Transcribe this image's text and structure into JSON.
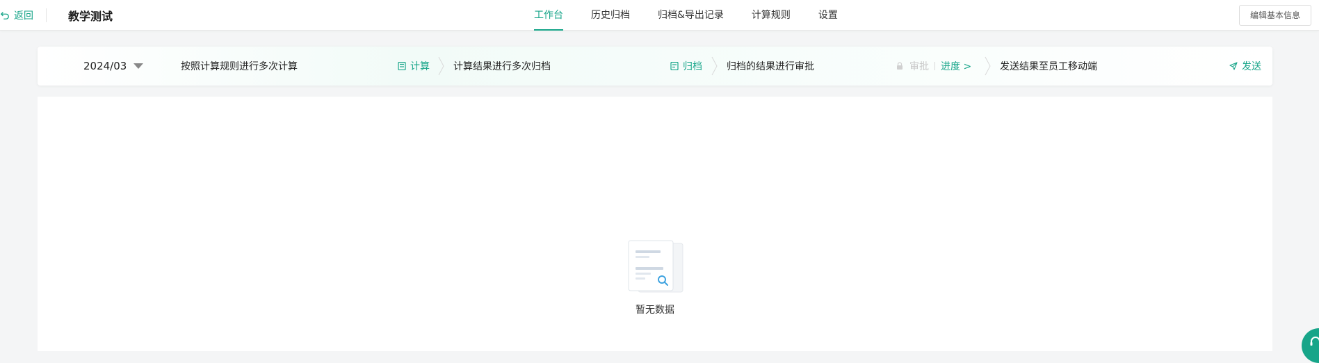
{
  "header": {
    "back_label": "返回",
    "app_title": "教学测试",
    "tabs": [
      {
        "label": "工作台",
        "active": true
      },
      {
        "label": "历史归档",
        "active": false
      },
      {
        "label": "归档&导出记录",
        "active": false
      },
      {
        "label": "计算规则",
        "active": false
      },
      {
        "label": "设置",
        "active": false
      }
    ],
    "edit_button_label": "编辑基本信息"
  },
  "workflow": {
    "period": "2024/03",
    "step1_text": "按照计算规则进行多次计算",
    "calc_action": "计算",
    "step2_text": "计算结果进行多次归档",
    "archive_action": "归档",
    "step3_text": "归档的结果进行审批",
    "approve_action": "审批",
    "progress_link": "进度 >",
    "step4_text": "发送结果至员工移动端",
    "send_action": "发送"
  },
  "main": {
    "empty_text": "暂无数据"
  },
  "colors": {
    "accent": "#17a589",
    "background": "#f4f5f6"
  },
  "icons": [
    "undo-icon",
    "calculator-icon",
    "archive-icon",
    "lock-icon",
    "send-icon",
    "chevron-right-icon",
    "caret-down-icon",
    "empty-document-icon",
    "headset-icon"
  ]
}
